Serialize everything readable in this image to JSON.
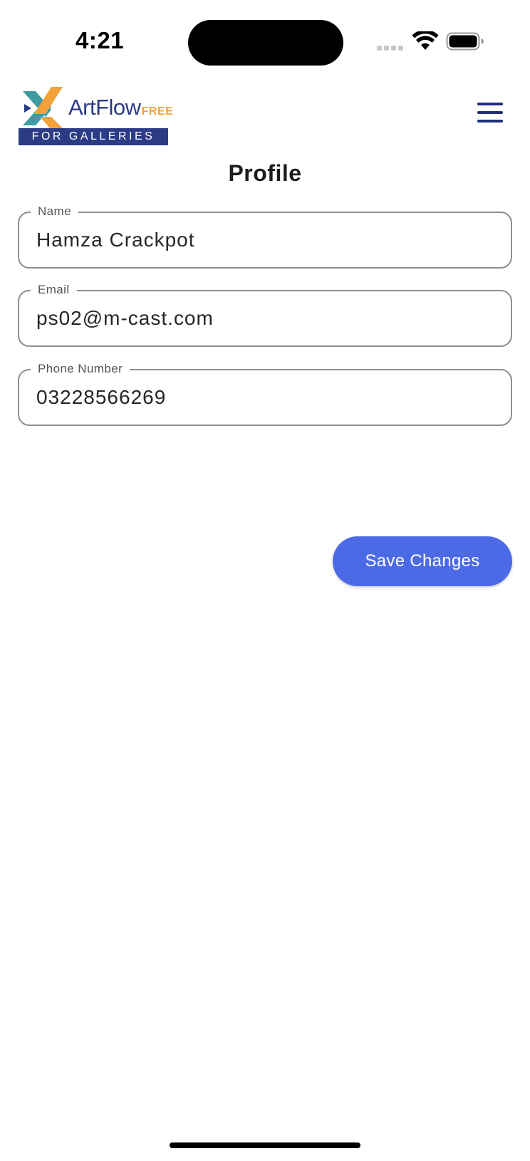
{
  "status_bar": {
    "time": "4:21",
    "icons": [
      "cellular-signal-icon",
      "wifi-icon",
      "battery-icon"
    ]
  },
  "header": {
    "logo": {
      "brand": "ArtFlow",
      "tier": "FREE",
      "tagline": "FOR GALLERIES",
      "colors": {
        "navy": "#2c3b86",
        "orange": "#f1a23a",
        "teal": "#3f9aa4"
      }
    },
    "menu_icon": "hamburger-menu-icon"
  },
  "page": {
    "title": "Profile"
  },
  "form": {
    "name": {
      "label": "Name",
      "value": "Hamza Crackpot"
    },
    "email": {
      "label": "Email",
      "value": "ps02@m-cast.com"
    },
    "phone": {
      "label": "Phone Number",
      "value": "03228566269"
    },
    "save_label": "Save Changes"
  },
  "colors": {
    "accent": "#4d6ae6",
    "menu_icon": "#1f2f78",
    "field_border": "#8f8f8f"
  }
}
